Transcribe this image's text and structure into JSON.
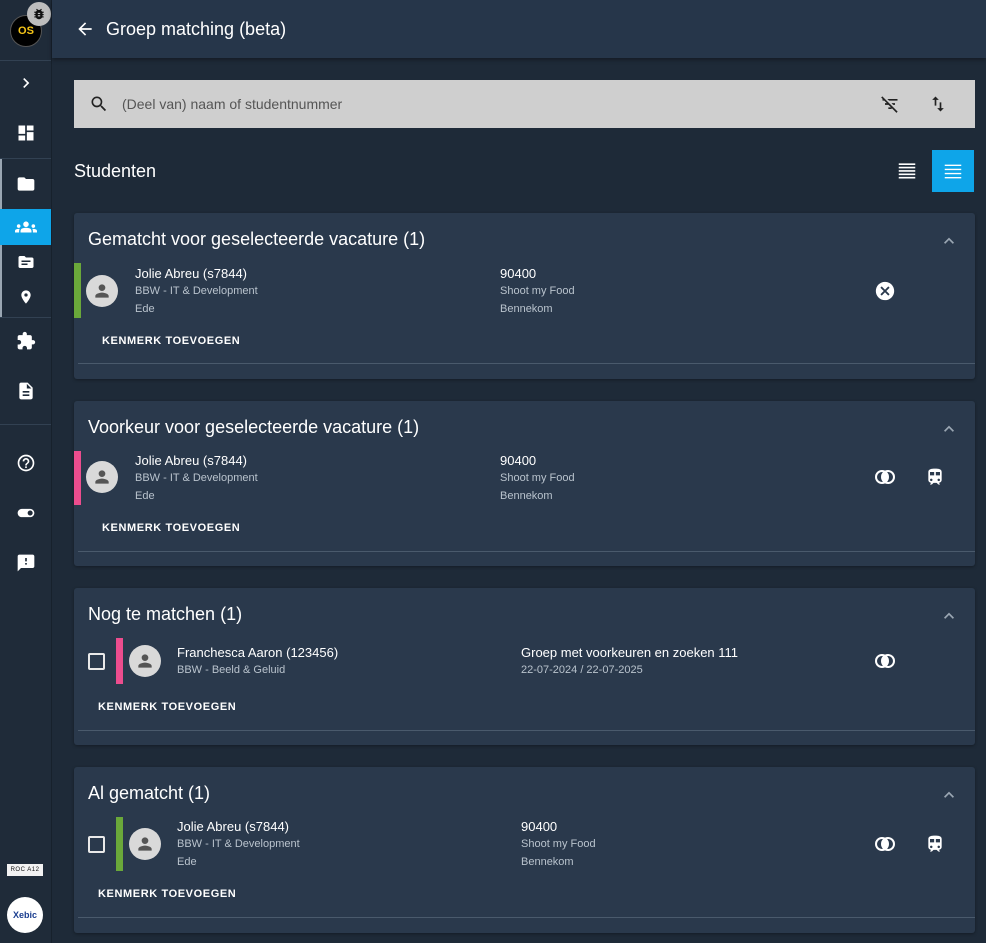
{
  "app": {
    "logo_text": "OS",
    "bottom_logo_1": "ROC A12",
    "bottom_logo_2": "Xebic"
  },
  "header": {
    "title": "Groep matching (beta)"
  },
  "search": {
    "placeholder": "(Deel van) naam of studentnummer"
  },
  "students": {
    "label": "Studenten"
  },
  "sections": [
    {
      "title": "Gematcht voor geselecteerde vacature (1)",
      "student": {
        "name": "Jolie Abreu (s7844)",
        "program": "BBW - IT & Development",
        "city": "Ede",
        "status_color": "#6aa83a"
      },
      "match": {
        "id": "90400",
        "company": "Shoot my Food",
        "city": "Bennekom"
      },
      "kenmerk": "KENMERK TOEVOEGEN"
    },
    {
      "title": "Voorkeur voor geselecteerde vacature (1)",
      "student": {
        "name": "Jolie Abreu (s7844)",
        "program": "BBW - IT & Development",
        "city": "Ede",
        "status_color": "#ec4d8e"
      },
      "match": {
        "id": "90400",
        "company": "Shoot my Food",
        "city": "Bennekom"
      },
      "kenmerk": "KENMERK TOEVOEGEN"
    },
    {
      "title": "Nog te matchen (1)",
      "student": {
        "name": "Franchesca Aaron (123456)",
        "program": "BBW - Beeld & Geluid",
        "status_color": "#ec4d8e"
      },
      "match": {
        "group": "Groep met voorkeuren en zoeken 111",
        "period": "22-07-2024 / 22-07-2025"
      },
      "kenmerk": "KENMERK TOEVOEGEN"
    },
    {
      "title": "Al gematcht (1)",
      "student": {
        "name": "Jolie Abreu (s7844)",
        "program": "BBW - IT & Development",
        "city": "Ede",
        "status_color": "#6aa83a"
      },
      "match": {
        "id": "90400",
        "company": "Shoot my Food",
        "city": "Bennekom"
      },
      "kenmerk": "KENMERK TOEVOEGEN"
    }
  ],
  "colors": {
    "accent": "#0ea5e9",
    "background": "#1e2a38",
    "panel": "#2a394c"
  },
  "icons": [
    "bug-icon",
    "chevron-right-icon",
    "dashboard-icon",
    "folder-icon",
    "group-icon",
    "folder-shared-icon",
    "location-icon",
    "puzzle-icon",
    "document-icon",
    "help-icon",
    "toggle-icon",
    "feedback-icon",
    "arrow-back-icon",
    "search-icon",
    "filter-off-icon",
    "sort-icon",
    "list-dense-icon",
    "list-icon",
    "chevron-up-icon",
    "person-icon",
    "cancel-icon",
    "match-icon",
    "train-icon"
  ]
}
